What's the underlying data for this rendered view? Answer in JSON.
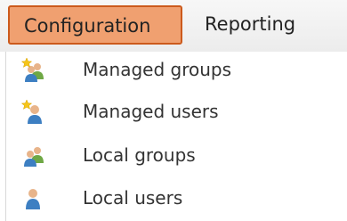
{
  "menubar": {
    "tabs": [
      {
        "label": "Configuration",
        "active": true
      },
      {
        "label": "Reporting",
        "active": false
      }
    ]
  },
  "dropdown": {
    "items": [
      {
        "label": "Managed groups",
        "icon": "managed-groups-icon"
      },
      {
        "label": "Managed users",
        "icon": "managed-user-icon"
      },
      {
        "label": "Local groups",
        "icon": "local-groups-icon"
      },
      {
        "label": "Local users",
        "icon": "local-user-icon"
      }
    ]
  },
  "colors": {
    "active_tab_fill": "#f0a070",
    "active_tab_border": "#cc5a1c",
    "star": "#f5c518",
    "person_green": "#6fa845",
    "person_blue": "#3d7fc2",
    "skin": "#e8b48a"
  }
}
